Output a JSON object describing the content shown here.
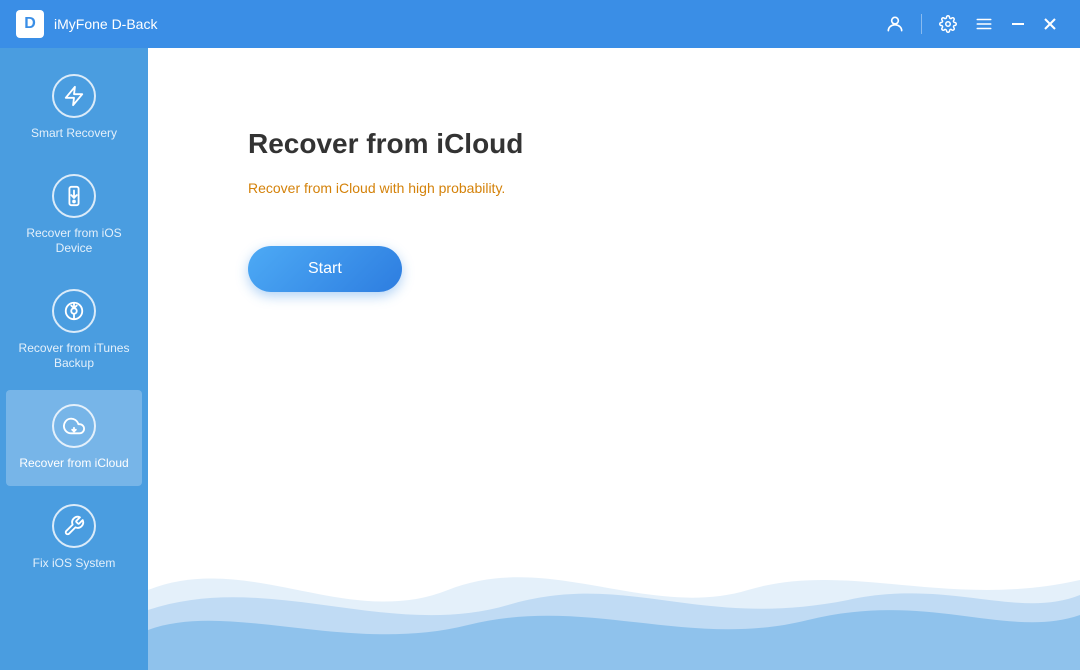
{
  "titlebar": {
    "app_name": "iMyFone D-Back",
    "logo_letter": "D"
  },
  "sidebar": {
    "items": [
      {
        "id": "smart-recovery",
        "label": "Smart Recovery",
        "icon": "⚡",
        "active": false
      },
      {
        "id": "recover-ios",
        "label": "Recover from iOS Device",
        "icon": "📱",
        "active": false
      },
      {
        "id": "recover-itunes",
        "label": "Recover from iTunes Backup",
        "icon": "🎵",
        "active": false
      },
      {
        "id": "recover-icloud",
        "label": "Recover from iCloud",
        "icon": "☁",
        "active": true
      },
      {
        "id": "fix-ios",
        "label": "Fix iOS System",
        "icon": "🔧",
        "active": false
      }
    ]
  },
  "content": {
    "title": "Recover from iCloud",
    "subtitle": "Recover from iCloud with high probability.",
    "start_button": "Start"
  },
  "colors": {
    "sidebar_bg": "#4a9de0",
    "titlebar_bg": "#3a8ee6",
    "active_item_bg": "rgba(255,255,255,0.25)",
    "subtitle_color": "#d4820a"
  }
}
